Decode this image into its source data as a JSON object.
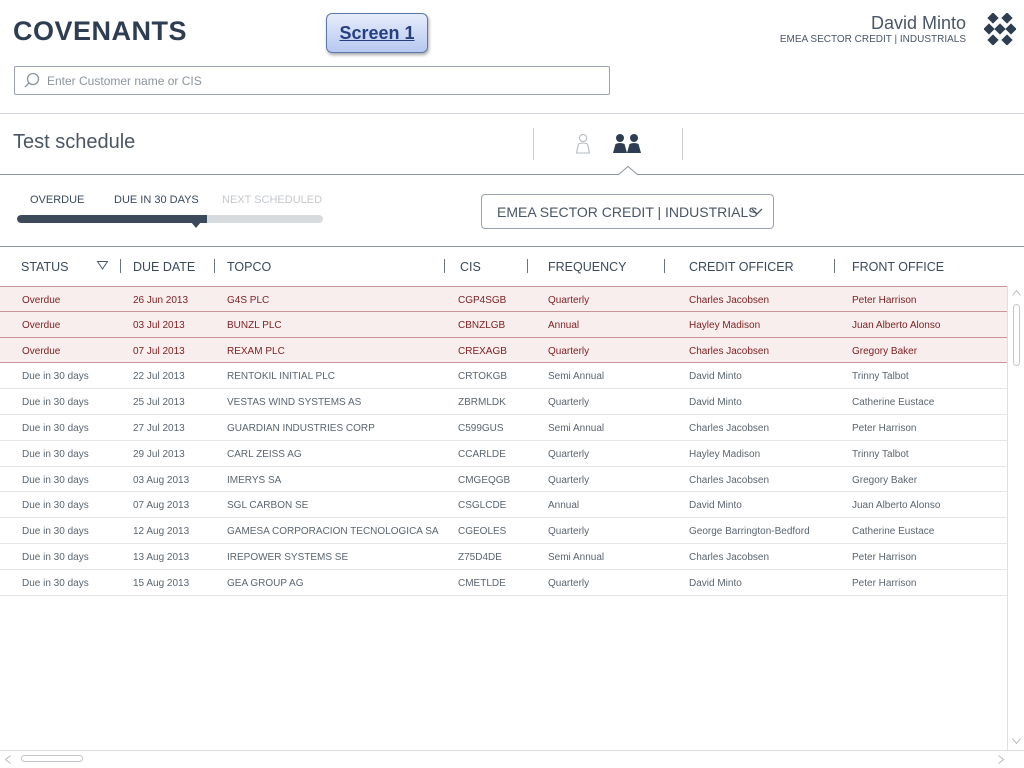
{
  "header": {
    "app_title": "COVENANTS",
    "screen_label": "Screen 1",
    "user_name": "David Minto",
    "user_department": "EMEA SECTOR CREDIT | INDUSTRIALS"
  },
  "search": {
    "placeholder": "Enter Customer name or CIS",
    "value": ""
  },
  "schedule": {
    "title": "Test schedule",
    "views": [
      "single-user",
      "group-users"
    ],
    "active_view": "group-users"
  },
  "tabs": {
    "overdue": "OVERDUE",
    "due_30": "DUE IN 30 DAYS",
    "next_scheduled": "NEXT SCHEDULED",
    "progress": 0.62
  },
  "sector_select": {
    "value": "EMEA SECTOR CREDIT | INDUSTRIALS"
  },
  "table": {
    "columns": {
      "status": "STATUS",
      "due_date": "DUE DATE",
      "topco": "TOPCO",
      "cis": "CIS",
      "frequency": "FREQUENCY",
      "credit_officer": "CREDIT OFFICER",
      "front_office": "FRONT OFFICE"
    },
    "rows": [
      {
        "status": "Overdue",
        "due_date": "26 Jun 2013",
        "topco": "G4S PLC",
        "cis": "CGP4SGB",
        "frequency": "Quarterly",
        "credit_officer": "Charles Jacobsen",
        "front_office": "Peter Harrison",
        "overdue": true
      },
      {
        "status": "Overdue",
        "due_date": "03 Jul 2013",
        "topco": "BUNZL PLC",
        "cis": "CBNZLGB",
        "frequency": "Annual",
        "credit_officer": "Hayley Madison",
        "front_office": "Juan Alberto Alonso",
        "overdue": true
      },
      {
        "status": "Overdue",
        "due_date": "07 Jul 2013",
        "topco": "REXAM PLC",
        "cis": "CREXAGB",
        "frequency": "Quarterly",
        "credit_officer": "Charles Jacobsen",
        "front_office": "Gregory Baker",
        "overdue": true
      },
      {
        "status": "Due in 30 days",
        "due_date": "22 Jul 2013",
        "topco": "RENTOKIL INITIAL PLC",
        "cis": "CRTOKGB",
        "frequency": "Semi Annual",
        "credit_officer": "David Minto",
        "front_office": "Trinny Talbot",
        "overdue": false
      },
      {
        "status": "Due in 30 days",
        "due_date": "25 Jul 2013",
        "topco": "VESTAS WIND SYSTEMS AS",
        "cis": "ZBRMLDK",
        "frequency": "Quarterly",
        "credit_officer": "David Minto",
        "front_office": "Catherine Eustace",
        "overdue": false
      },
      {
        "status": "Due in 30 days",
        "due_date": "27 Jul 2013",
        "topco": "GUARDIAN INDUSTRIES CORP",
        "cis": "C599GUS",
        "frequency": "Semi Annual",
        "credit_officer": "Charles Jacobsen",
        "front_office": "Peter Harrison",
        "overdue": false
      },
      {
        "status": "Due in 30 days",
        "due_date": "29 Jul 2013",
        "topco": "CARL ZEISS AG",
        "cis": "CCARLDE",
        "frequency": "Quarterly",
        "credit_officer": "Hayley Madison",
        "front_office": "Trinny Talbot",
        "overdue": false
      },
      {
        "status": "Due in 30 days",
        "due_date": "03 Aug 2013",
        "topco": "IMERYS SA",
        "cis": "CMGEQGB",
        "frequency": "Quarterly",
        "credit_officer": "Charles Jacobsen",
        "front_office": "Gregory Baker",
        "overdue": false
      },
      {
        "status": "Due in 30 days",
        "due_date": "07 Aug 2013",
        "topco": "SGL CARBON SE",
        "cis": "CSGLCDE",
        "frequency": "Annual",
        "credit_officer": "David Minto",
        "front_office": "Juan Alberto Alonso",
        "overdue": false
      },
      {
        "status": "Due in 30 days",
        "due_date": "12 Aug 2013",
        "topco": "GAMESA CORPORACION TECNOLOGICA SA",
        "cis": "CGEOLES",
        "frequency": "Quarterly",
        "credit_officer": "George Barrington-Bedford",
        "front_office": "Catherine Eustace",
        "overdue": false
      },
      {
        "status": "Due in 30 days",
        "due_date": "13 Aug 2013",
        "topco": "IREPOWER SYSTEMS SE",
        "cis": "Z75D4DE",
        "frequency": "Semi Annual",
        "credit_officer": "Charles Jacobsen",
        "front_office": "Peter Harrison",
        "overdue": false
      },
      {
        "status": "Due in 30 days",
        "due_date": "15 Aug 2013",
        "topco": "GEA GROUP AG",
        "cis": "CMETLDE",
        "frequency": "Quarterly",
        "credit_officer": "David Minto",
        "front_office": "Peter Harrison",
        "overdue": false
      }
    ]
  },
  "colors": {
    "title": "#2e3e52",
    "overdue_text": "#7d1f1f",
    "overdue_bg": "#f8eeee",
    "progress_fill": "#3c4a5c"
  },
  "icons": {
    "search": "search-icon",
    "logo": "brand-logo-icon",
    "single_user": "user-icon",
    "group_users": "users-group-icon",
    "sort": "sort-down-icon",
    "dropdown": "chevron-down-icon"
  }
}
